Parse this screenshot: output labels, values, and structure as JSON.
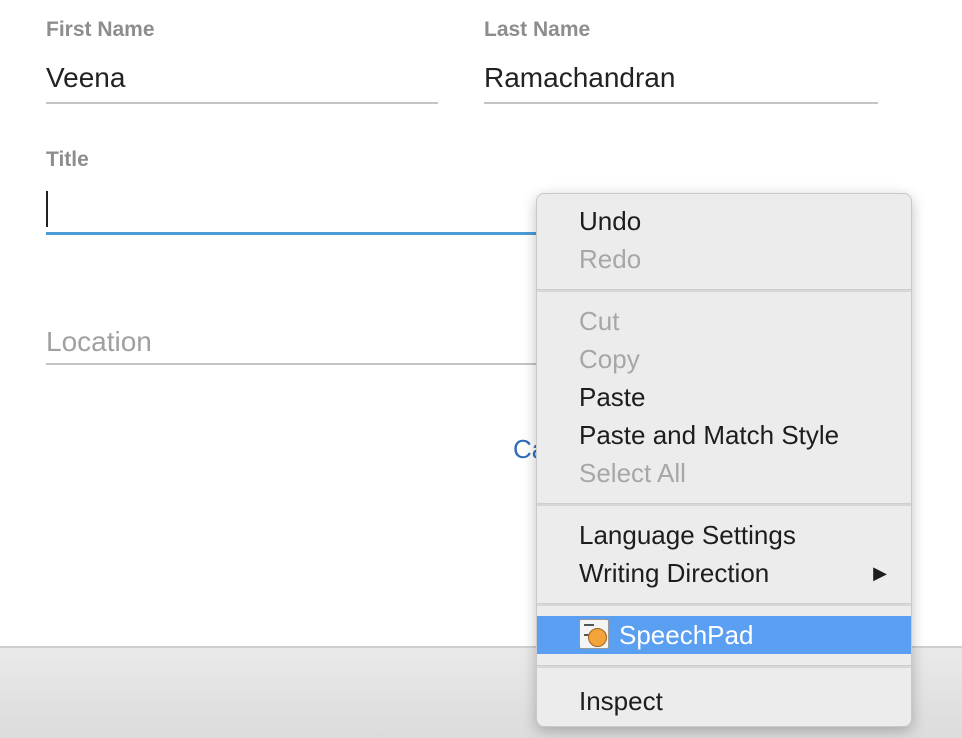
{
  "form": {
    "first_name": {
      "label": "First Name",
      "value": "Veena"
    },
    "last_name": {
      "label": "Last Name",
      "value": "Ramachandran"
    },
    "title": {
      "label": "Title",
      "value": ""
    },
    "location": {
      "placeholder": "Location"
    },
    "cancel_label": "Ca"
  },
  "context_menu": {
    "undo": "Undo",
    "redo": "Redo",
    "cut": "Cut",
    "copy": "Copy",
    "paste": "Paste",
    "paste_match": "Paste and Match Style",
    "select_all": "Select All",
    "language_settings": "Language Settings",
    "writing_direction": "Writing Direction",
    "speechpad": "SpeechPad",
    "inspect": "Inspect",
    "submenu_arrow": "▶"
  },
  "colors": {
    "accent": "#4a9bd6",
    "highlight": "#5a9ff1",
    "link": "#2f6db8"
  }
}
